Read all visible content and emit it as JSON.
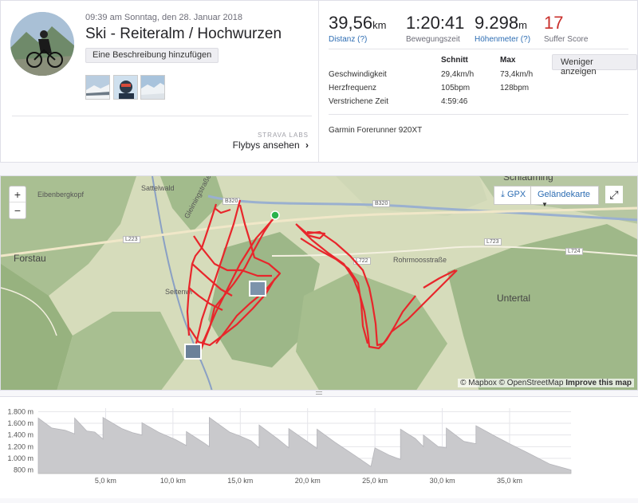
{
  "header": {
    "datetime": "09:39 am Sonntag, den 28. Januar 2018",
    "title": "Ski - Reiteralm / Hochwurzen",
    "description_button": "Eine Beschreibung hinzufügen",
    "strava_labs": "STRAVA LABS",
    "flybys": "Flybys ansehen",
    "flybys_chevron": "›"
  },
  "stats": {
    "distance": {
      "value": "39,56",
      "unit": "km",
      "label": "Distanz (?)"
    },
    "moving_time": {
      "value": "1:20:41",
      "label": "Bewegungszeit"
    },
    "elevation": {
      "value": "9.298",
      "unit": "m",
      "label": "Höhenmeter (?)"
    },
    "suffer": {
      "value": "17",
      "label": "Suffer Score"
    }
  },
  "less_button": "Weniger anzeigen",
  "metrics": {
    "headers": [
      "",
      "Schnitt",
      "Max"
    ],
    "rows": [
      [
        "Geschwindigkeit",
        "29,4km/h",
        "73,4km/h"
      ],
      [
        "Herzfrequenz",
        "105bpm",
        "128bpm"
      ],
      [
        "Verstrichene Zeit",
        "4:59:46",
        ""
      ]
    ]
  },
  "device": "Garmin Forerunner 920XT",
  "map": {
    "zoom_in": "+",
    "zoom_out": "−",
    "gpx": "GPX",
    "terrain": "Geländekarte",
    "attribution_mapbox": "© Mapbox",
    "attribution_osm": "© OpenStreetMap",
    "attribution_improve": "Improve this map",
    "labels": [
      {
        "text": "Eibenbergkopf"
      },
      {
        "text": "Sattelwald"
      },
      {
        "text": "Forstau"
      },
      {
        "text": "Seitenwi"
      },
      {
        "text": "Untertal"
      },
      {
        "text": "Schladming"
      },
      {
        "text": "Rohrmoosstraße"
      },
      {
        "text": "Gleimingstraße"
      }
    ],
    "road_signs": [
      "B320",
      "B320",
      "L223",
      "L722",
      "L723",
      "L724"
    ],
    "icons": {
      "start": "start-marker-icon",
      "photo": "photo-marker-icon"
    },
    "colors": {
      "route": "#e8262b",
      "start": "#2bb24c"
    }
  },
  "chart_data": {
    "type": "area",
    "xlabel": "",
    "ylabel": "",
    "x_ticks": [
      "5,0 km",
      "10,0 km",
      "15,0 km",
      "20,0 km",
      "25,0 km",
      "30,0 km",
      "35,0 km"
    ],
    "x_tick_values": [
      5,
      10,
      15,
      20,
      25,
      30,
      35
    ],
    "y_ticks": [
      "1.800 m",
      "1.600 m",
      "1.400 m",
      "1.200 m",
      "1.000 m",
      "800 m"
    ],
    "y_tick_values": [
      1800,
      1600,
      1400,
      1200,
      1000,
      800
    ],
    "xlim": [
      0,
      39.56
    ],
    "ylim": [
      740,
      1860
    ],
    "series": [
      {
        "values": [
          [
            0,
            1690
          ],
          [
            1.0,
            1520
          ],
          [
            2.0,
            1480
          ],
          [
            2.7,
            1420
          ],
          [
            2.7,
            1690
          ],
          [
            3.6,
            1470
          ],
          [
            4.2,
            1450
          ],
          [
            4.8,
            1330
          ],
          [
            4.8,
            1700
          ],
          [
            6.2,
            1510
          ],
          [
            7.0,
            1440
          ],
          [
            7.7,
            1400
          ],
          [
            7.7,
            1610
          ],
          [
            9.0,
            1440
          ],
          [
            10.2,
            1320
          ],
          [
            11.0,
            1220
          ],
          [
            11.0,
            1460
          ],
          [
            12.4,
            1250
          ],
          [
            12.7,
            1200
          ],
          [
            12.7,
            1700
          ],
          [
            14.2,
            1450
          ],
          [
            15.0,
            1380
          ],
          [
            15.8,
            1300
          ],
          [
            16.4,
            1180
          ],
          [
            16.4,
            1570
          ],
          [
            17.8,
            1330
          ],
          [
            18.6,
            1180
          ],
          [
            18.6,
            1510
          ],
          [
            19.9,
            1300
          ],
          [
            20.7,
            1170
          ],
          [
            20.7,
            1500
          ],
          [
            22.0,
            1280
          ],
          [
            23.5,
            1050
          ],
          [
            24.7,
            860
          ],
          [
            25.0,
            1180
          ],
          [
            26.1,
            1050
          ],
          [
            26.9,
            980
          ],
          [
            26.9,
            1500
          ],
          [
            28.0,
            1340
          ],
          [
            28.6,
            1200
          ],
          [
            28.6,
            1400
          ],
          [
            29.7,
            1200
          ],
          [
            30.3,
            1180
          ],
          [
            30.3,
            1520
          ],
          [
            31.6,
            1290
          ],
          [
            32.5,
            1250
          ],
          [
            32.5,
            1560
          ],
          [
            34.0,
            1370
          ],
          [
            35.0,
            1250
          ],
          [
            36.3,
            1100
          ],
          [
            38.0,
            900
          ],
          [
            39.56,
            800
          ]
        ]
      }
    ],
    "colors": {
      "area": "#c9c9cc",
      "grid": "#e5e5ea"
    }
  }
}
